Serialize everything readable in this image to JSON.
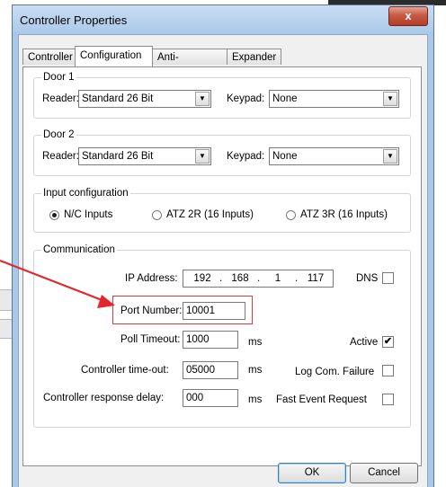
{
  "window": {
    "title": "Controller Properties",
    "close_glyph": "x"
  },
  "tabs": [
    {
      "label": "Controller"
    },
    {
      "label": "Configuration"
    },
    {
      "label": "Anti-passback"
    },
    {
      "label": "Expander"
    }
  ],
  "door1": {
    "legend": "Door 1",
    "reader_label": "Reader:",
    "reader_value": "Standard 26 Bit",
    "keypad_label": "Keypad:",
    "keypad_value": "None"
  },
  "door2": {
    "legend": "Door 2",
    "reader_label": "Reader:",
    "reader_value": "Standard 26 Bit",
    "keypad_label": "Keypad:",
    "keypad_value": "None"
  },
  "input_config": {
    "legend": "Input configuration",
    "options": [
      {
        "label": "N/C Inputs",
        "selected": true
      },
      {
        "label": "ATZ 2R (16 Inputs)",
        "selected": false
      },
      {
        "label": "ATZ 3R (16 Inputs)",
        "selected": false
      }
    ]
  },
  "communication": {
    "legend": "Communication",
    "ip_label": "IP Address:",
    "ip": [
      "192",
      "168",
      "1",
      "117"
    ],
    "dns_label": "DNS",
    "dns_checked": false,
    "port_label": "Port Number:",
    "port_value": "10001",
    "poll_label": "Poll Timeout:",
    "poll_value": "1000",
    "poll_unit": "ms",
    "active_label": "Active",
    "active_checked": true,
    "timeout_label": "Controller time-out:",
    "timeout_value": "05000",
    "timeout_unit": "ms",
    "logfail_label": "Log Com. Failure",
    "logfail_checked": false,
    "delay_label": "Controller response delay:",
    "delay_value": "000",
    "delay_unit": "ms",
    "fastevent_label": "Fast Event Request",
    "fastevent_checked": false
  },
  "buttons": {
    "ok": "OK",
    "cancel": "Cancel"
  },
  "icons": {
    "combo_arrow": "chevron-down-icon",
    "check_mark": "✔",
    "annotation": "red-arrow-icon"
  },
  "colors": {
    "highlight": "#d93a3a",
    "title_bar": "#aac9ea",
    "close_button": "#c75a44"
  }
}
